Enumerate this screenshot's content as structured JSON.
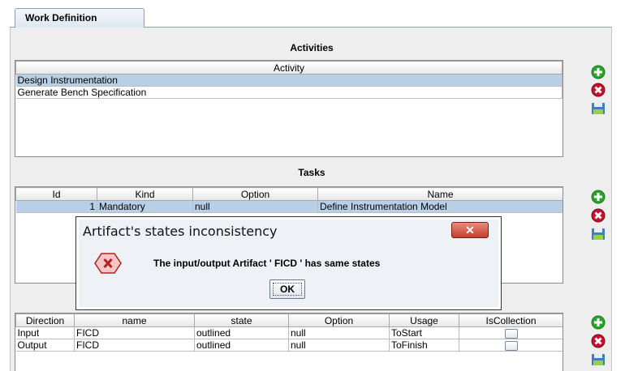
{
  "tab": {
    "label": "Work Definition"
  },
  "activities": {
    "title": "Activities",
    "column": "Activity",
    "rows": [
      "Design Instrumentation",
      "Generate Bench Specification"
    ]
  },
  "tasks": {
    "title": "Tasks",
    "columns": [
      "Id",
      "Kind",
      "Option",
      "Name"
    ],
    "rows": [
      {
        "id": "1",
        "kind": "Mandatory",
        "option": "null",
        "name": "Define Instrumentation Model"
      }
    ]
  },
  "artifacts": {
    "columns": [
      "Direction",
      "name",
      "state",
      "Option",
      "Usage",
      "IsCollection"
    ],
    "rows": [
      {
        "direction": "Input",
        "name": "FICD",
        "state": "outlined",
        "option": "null",
        "usage": "ToStart"
      },
      {
        "direction": "Output",
        "name": "FICD",
        "state": "outlined",
        "option": "null",
        "usage": "ToFinish"
      }
    ]
  },
  "dialog": {
    "title": "Artifact's states inconsistency",
    "message": "The input/output Artifact ' FICD '  has same states",
    "ok_label": "OK",
    "close_label": "✕"
  },
  "colors": {
    "add_icon": "#2aa52a",
    "delete_icon": "#c8102e",
    "selected_row": "#b8cfe5"
  },
  "icons": [
    "add-icon",
    "delete-icon",
    "save-icon",
    "error-icon"
  ]
}
